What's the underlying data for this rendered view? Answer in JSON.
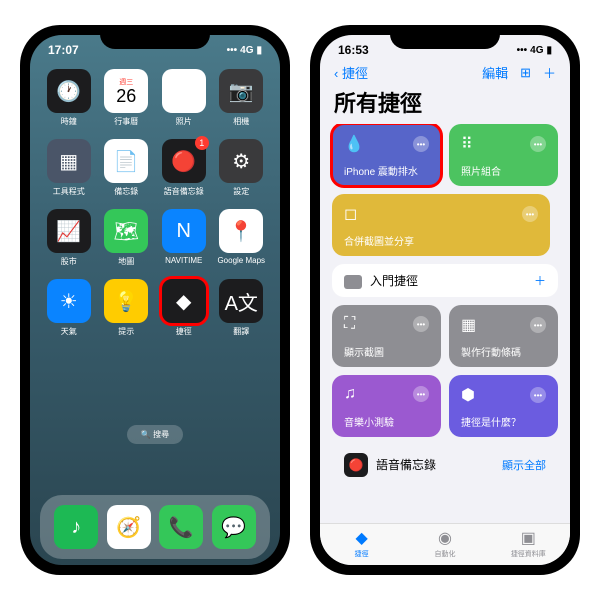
{
  "left": {
    "time": "17:07",
    "signal": "4G",
    "apps": [
      {
        "label": "時鐘",
        "bg": "#1c1c1e",
        "glyph": "🕐"
      },
      {
        "label": "行事曆",
        "bg": "#fff",
        "glyph": "",
        "cal_day": "週三",
        "cal_num": "26"
      },
      {
        "label": "照片",
        "bg": "#fff",
        "glyph": "❀"
      },
      {
        "label": "相機",
        "bg": "#3a3a3c",
        "glyph": "📷"
      },
      {
        "label": "工具程式",
        "bg": "#4a5568",
        "glyph": "▦"
      },
      {
        "label": "備忘錄",
        "bg": "#fff",
        "glyph": "📄"
      },
      {
        "label": "語音備忘錄",
        "bg": "#1c1c1e",
        "glyph": "🔴",
        "badge": "1"
      },
      {
        "label": "設定",
        "bg": "#3a3a3c",
        "glyph": "⚙"
      },
      {
        "label": "股市",
        "bg": "#1c1c1e",
        "glyph": "📈"
      },
      {
        "label": "地圖",
        "bg": "#34c759",
        "glyph": "🗺"
      },
      {
        "label": "NAVITIME",
        "bg": "#0a84ff",
        "glyph": "N"
      },
      {
        "label": "Google Maps",
        "bg": "#fff",
        "glyph": "📍"
      },
      {
        "label": "天氣",
        "bg": "#0a84ff",
        "glyph": "☀"
      },
      {
        "label": "提示",
        "bg": "#ffcc00",
        "glyph": "💡"
      },
      {
        "label": "捷徑",
        "bg": "#1c1c1e",
        "glyph": "◆",
        "highlight": true
      },
      {
        "label": "翻譯",
        "bg": "#1c1c1e",
        "glyph": "A文"
      }
    ],
    "search": "🔍 搜尋",
    "dock": [
      {
        "bg": "#1db954",
        "glyph": "♪"
      },
      {
        "bg": "#fff",
        "glyph": "🧭"
      },
      {
        "bg": "#34c759",
        "glyph": "📞"
      },
      {
        "bg": "#34c759",
        "glyph": "💬"
      }
    ]
  },
  "right": {
    "time": "16:53",
    "signal": "4G",
    "back": "捷徑",
    "edit": "編輯",
    "title": "所有捷徑",
    "cards": [
      {
        "label": "iPhone 震動排水",
        "bg": "#5765c9",
        "icon": "💧",
        "highlight": true
      },
      {
        "label": "照片組合",
        "bg": "#4cc360",
        "icon": "⠿"
      },
      {
        "label": "合併截圖並分享",
        "bg": "#e0b93a",
        "icon": "◻"
      }
    ],
    "starter_section": "入門捷徑",
    "starter": [
      {
        "label": "顯示截圖",
        "bg": "#8e8e93",
        "icon": "⛶"
      },
      {
        "label": "製作行動條碼",
        "bg": "#8e8e93",
        "icon": "▦"
      },
      {
        "label": "音樂小測驗",
        "bg": "#9b59d0",
        "icon": "♫"
      },
      {
        "label": "捷徑是什麼？",
        "bg": "#6b5ce0",
        "icon": "⬢"
      }
    ],
    "list_item": "語音備忘錄",
    "show_all": "顯示全部",
    "tabs": [
      {
        "label": "捷徑",
        "icon": "◆",
        "active": true
      },
      {
        "label": "自動化",
        "icon": "◉",
        "active": false
      },
      {
        "label": "捷徑資料庫",
        "icon": "▣",
        "active": false
      }
    ]
  }
}
